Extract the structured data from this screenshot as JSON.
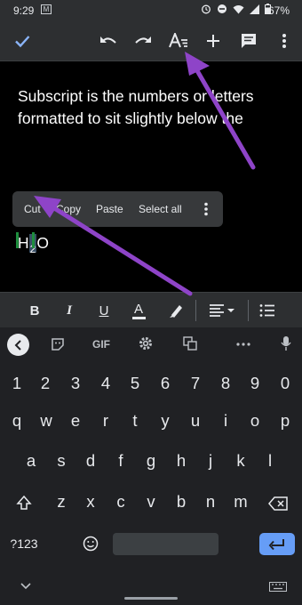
{
  "status_bar": {
    "time": "9:29",
    "gmail_glyph": "M",
    "battery": "67%"
  },
  "toolbar": {
    "check_icon": "check-icon",
    "undo_icon": "undo-icon",
    "redo_icon": "redo-icon",
    "text_format_icon": "text-format-icon",
    "add_icon": "add-icon",
    "comment_icon": "comment-icon",
    "more_icon": "more-vert-icon",
    "accent": "#8ab4f8"
  },
  "document": {
    "paragraph": "Subscript is the numbers or letters formatted to sit slightly below the",
    "formula": {
      "before": "H",
      "selected": "2",
      "after": "O"
    }
  },
  "context_menu": {
    "cut": "Cut",
    "copy": "Copy",
    "paste": "Paste",
    "select_all": "Select all"
  },
  "format_bar": {
    "bold": "B",
    "italic": "I",
    "underline": "U",
    "text_color": "A",
    "highlight_icon": "highlighter-icon",
    "align_icon": "align-left-icon",
    "list_icon": "list-icon"
  },
  "keyboard": {
    "suggestion_gif": "GIF",
    "number_row": [
      "1",
      "2",
      "3",
      "4",
      "5",
      "6",
      "7",
      "8",
      "9",
      "0"
    ],
    "row1": [
      "q",
      "w",
      "e",
      "r",
      "t",
      "y",
      "u",
      "i",
      "o",
      "p"
    ],
    "row2": [
      "a",
      "s",
      "d",
      "f",
      "g",
      "h",
      "j",
      "k",
      "l"
    ],
    "row3": [
      "z",
      "x",
      "c",
      "v",
      "b",
      "n",
      "m"
    ],
    "symbols_label": "?123",
    "enter_color": "#669df6"
  },
  "annotation_color": "#8e44c8"
}
